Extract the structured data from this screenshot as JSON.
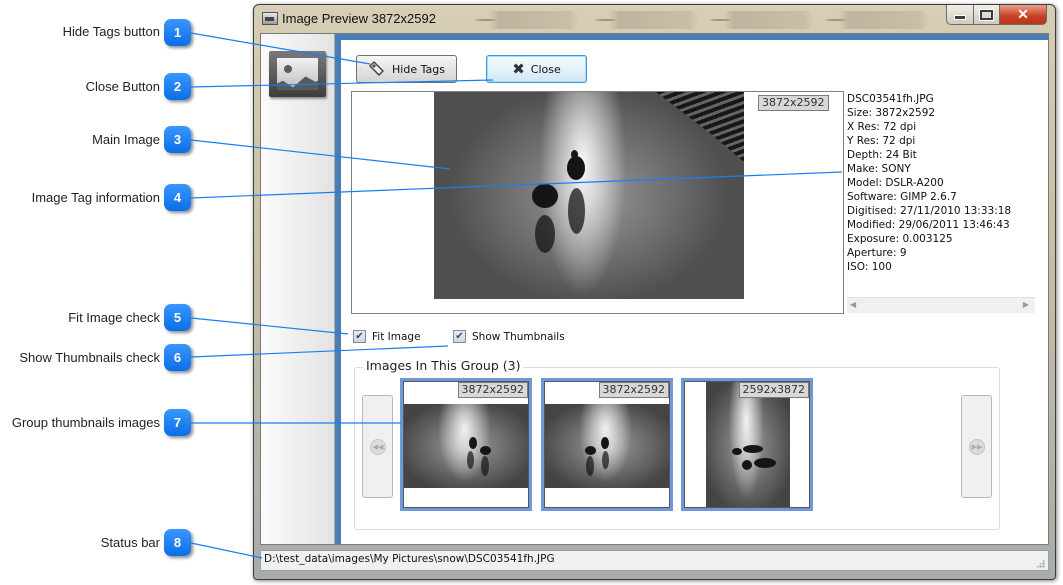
{
  "callouts": [
    {
      "number": "1",
      "label": "Hide Tags button"
    },
    {
      "number": "2",
      "label": "Close Button"
    },
    {
      "number": "3",
      "label": "Main Image"
    },
    {
      "number": "4",
      "label": "Image Tag information"
    },
    {
      "number": "5",
      "label": "Fit Image check"
    },
    {
      "number": "6",
      "label": "Show Thumbnails check"
    },
    {
      "number": "7",
      "label": "Group thumbnails images"
    },
    {
      "number": "8",
      "label": "Status bar"
    }
  ],
  "window": {
    "title": "Image Preview 3872x2592",
    "controls": {
      "minimize": "minimize",
      "maximize": "maximize",
      "close": "✕"
    }
  },
  "toolbar": {
    "hide_tags_label": "Hide Tags",
    "close_label": "Close"
  },
  "main_image": {
    "resolution_tag": "3872x2592"
  },
  "tags": [
    "DSC03541fh.JPG",
    "Size: 3872x2592",
    "X Res: 72 dpi",
    "Y Res: 72 dpi",
    "Depth: 24 Bit",
    "Make: SONY",
    "Model: DSLR-A200",
    "Software: GIMP 2.6.7",
    "Digitised: 27/11/2010 13:33:18",
    "Modified: 29/06/2011 13:46:43",
    "Exposure: 0.003125",
    "Aperture: 9",
    "ISO: 100"
  ],
  "options": {
    "fit_image": {
      "label": "Fit Image",
      "checked": true
    },
    "show_thumbnails": {
      "label": "Show Thumbnails",
      "checked": true
    }
  },
  "group": {
    "title": "Images In This Group (3)",
    "thumbnails": [
      {
        "resolution": "3872x2592",
        "orientation": "landscape",
        "selected": true
      },
      {
        "resolution": "3872x2592",
        "orientation": "landscape-mirrored",
        "selected": true
      },
      {
        "resolution": "2592x3872",
        "orientation": "portrait",
        "selected": true
      }
    ]
  },
  "status_bar": {
    "path": "D:\\test_data\\images\\My Pictures\\snow\\DSC03541fh.JPG"
  },
  "colors": {
    "callout_blue": "#1a7ef2",
    "accent_border": "#4a7db3",
    "thumb_selected": "#6f98d8",
    "close_red": "#c73f22"
  }
}
